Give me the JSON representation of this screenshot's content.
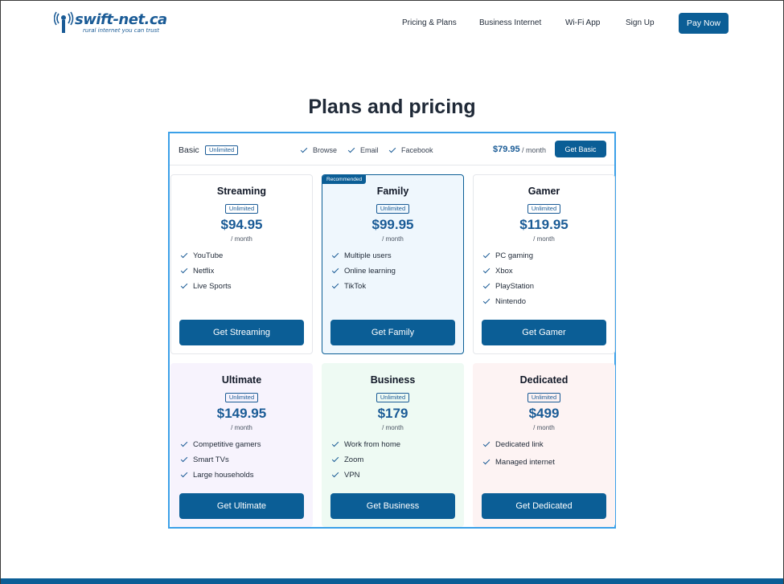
{
  "brand": {
    "name": "swift-net.ca",
    "tagline": "rural internet you can trust",
    "accent": "#0b5e96",
    "price_color": "#1a5b96"
  },
  "nav": {
    "items": [
      "Pricing & Plans",
      "Business Internet",
      "Wi-Fi App",
      "Sign Up"
    ],
    "cta": "Pay Now"
  },
  "page": {
    "title": "Plans and pricing"
  },
  "basic": {
    "name": "Basic",
    "badge": "Unlimited",
    "features": [
      "Browse",
      "Email",
      "Facebook"
    ],
    "price": "$79.95",
    "per": "/ month",
    "cta": "Get Basic"
  },
  "plans": [
    {
      "name": "Streaming",
      "badge": "Unlimited",
      "price": "$94.95",
      "per": "/ month",
      "features": [
        "YouTube",
        "Netflix",
        "Live Sports"
      ],
      "cta": "Get Streaming"
    },
    {
      "name": "Family",
      "badge": "Unlimited",
      "price": "$99.95",
      "per": "/ month",
      "tag": "Recommended",
      "features": [
        "Multiple users",
        "Online learning",
        "TikTok"
      ],
      "cta": "Get Family"
    },
    {
      "name": "Gamer",
      "badge": "Unlimited",
      "price": "$119.95",
      "per": "/ month",
      "features": [
        "PC gaming",
        "Xbox",
        "PlayStation",
        "Nintendo"
      ],
      "cta": "Get Gamer"
    },
    {
      "name": "Ultimate",
      "badge": "Unlimited",
      "price": "$149.95",
      "per": "/ month",
      "features": [
        "Competitive gamers",
        "Smart TVs",
        "Large households"
      ],
      "cta": "Get Ultimate"
    },
    {
      "name": "Business",
      "badge": "Unlimited",
      "price": "$179",
      "per": "/ month",
      "features": [
        "Work from home",
        "Zoom",
        "VPN"
      ],
      "cta": "Get Business"
    },
    {
      "name": "Dedicated",
      "badge": "Unlimited",
      "price": "$499",
      "per": "/ month",
      "features": [
        "Dedicated link",
        "Managed internet"
      ],
      "cta": "Get Dedicated"
    }
  ]
}
